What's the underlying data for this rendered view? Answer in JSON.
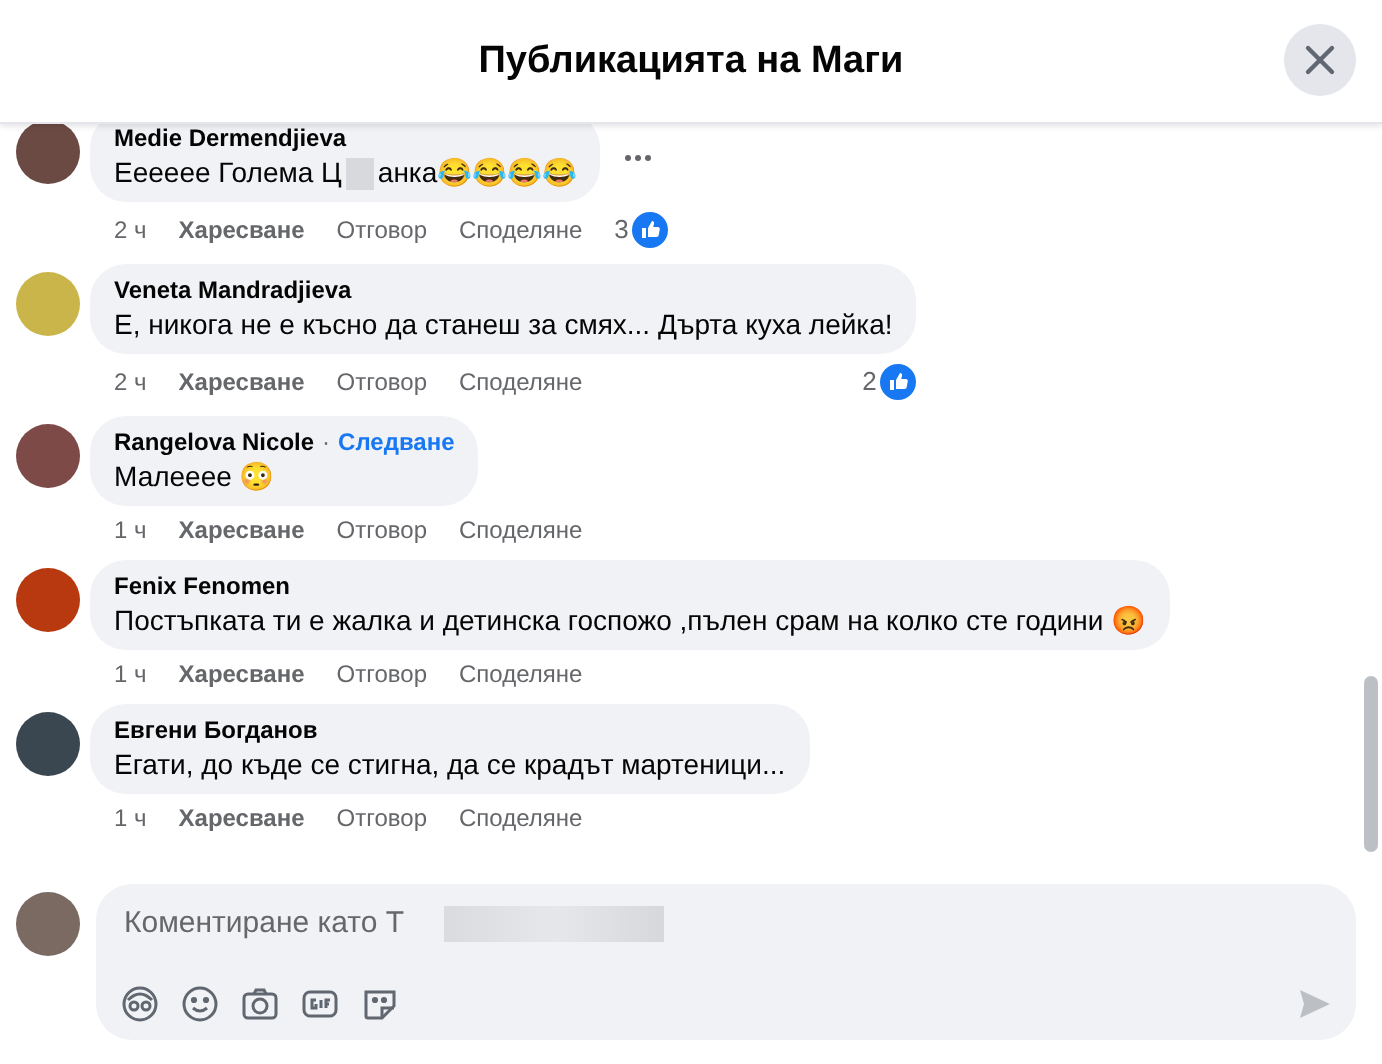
{
  "header": {
    "title": "Публикацията на Маги"
  },
  "comments": [
    {
      "author": "Medie Dermendjieva",
      "text_parts": [
        "Ееееее Голема Ц",
        "анка😂😂😂😂"
      ],
      "time": "2 ч",
      "actions": [
        "Харесване",
        "Отговор",
        "Споделяне"
      ],
      "reactions": "3",
      "more_menu": true
    },
    {
      "author": "Veneta Mandradjieva",
      "text_parts": [
        "Е, никога не е късно да станеш за смях... Дърта куха лейка!"
      ],
      "time": "2 ч",
      "actions": [
        "Харесване",
        "Отговор",
        "Споделяне"
      ],
      "reactions": "2",
      "more_menu": false
    },
    {
      "author": "Rangelova Nicole",
      "separator": "·",
      "follow": "Следване",
      "text_parts": [
        "Малееее 😳"
      ],
      "time": "1 ч",
      "actions": [
        "Харесване",
        "Отговор",
        "Споделяне"
      ],
      "more_menu": false
    },
    {
      "author": "Fenix Fenomen",
      "text_parts": [
        "Постъпката ти е жалка и детинска госпожо ,пълен срам на колко сте години 😡"
      ],
      "time": "1 ч",
      "actions": [
        "Харесване",
        "Отговор",
        "Споделяне"
      ],
      "more_menu": false
    },
    {
      "author": "Евгени Богданов",
      "text_parts": [
        "Егати, до къде се стигна, да се крадът мартеници..."
      ],
      "time": "1 ч",
      "actions": [
        "Харесване",
        "Отговор",
        "Споделяне"
      ],
      "more_menu": false
    }
  ],
  "composer": {
    "placeholder": "Коментиране като Т"
  }
}
